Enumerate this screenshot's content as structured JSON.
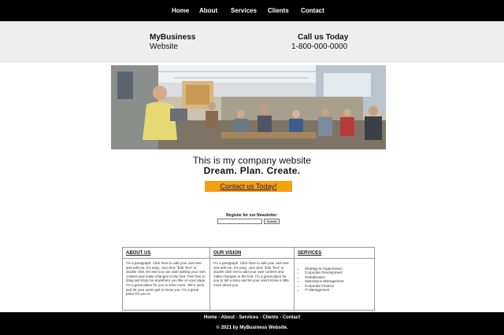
{
  "nav": {
    "items": [
      {
        "label": "Home"
      },
      {
        "label": "About"
      },
      {
        "label": "Services"
      },
      {
        "label": "Clients"
      },
      {
        "label": "Contact"
      }
    ]
  },
  "header": {
    "brand_name": "MyBusiness",
    "brand_sub": "Website",
    "call_title": "Call us Today",
    "call_phone": "1-800-000-0000"
  },
  "hero": {
    "tagline": "This is my company website",
    "headline": "Dream. Plan. Create.",
    "contact_button": "Contact us Today!"
  },
  "newsletter": {
    "label": "Register for our Newsletter:",
    "input_value": "",
    "submit_label": "Submit"
  },
  "columns": [
    {
      "title": "ABOUT US",
      "text": "I'm a paragraph. Click here to add your own text and edit me. It's easy. Just click \"Edit Text\" or double click me and you can start adding your own content and make changes to the font. Feel free to drag and drop me anywhere you like on your page. I'm a great place for you to write more. Tell a story and let your users get to know you. I'm a great place for you to"
    },
    {
      "title": "OUR VISION",
      "text": "I'm a paragraph. Click here to add your own text and edit me. It's easy. Just click \"Edit Text\" or double click me to add your own content and make changes to the font. I'm a great place for you to tell a story and let your users know a little more about you."
    },
    {
      "title": "SERVICES",
      "items": [
        "Strategy & Organization",
        "Corporate Development",
        "Globalization",
        "Operations Management",
        "Corporate Finance",
        "IT Management"
      ]
    }
  ],
  "footer": {
    "links": [
      "Home",
      "About",
      "Services",
      "Clients",
      "Contact"
    ],
    "separator": " - ",
    "copyright": "© 2021 by MyBusiness Website."
  },
  "colors": {
    "nav_bg": "#000000",
    "header_bg": "#eeeeee",
    "button_bg": "#f2a20f",
    "button_text": "#2a1266"
  }
}
